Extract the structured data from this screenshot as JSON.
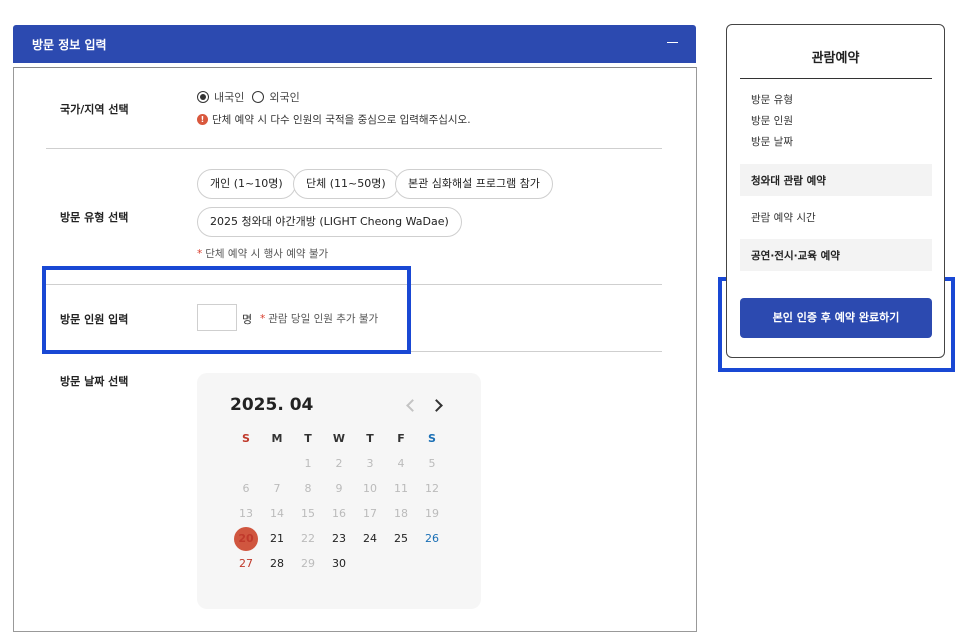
{
  "form": {
    "title": "방문 정보 입력",
    "nationality": {
      "label": "국가/지역 선택",
      "options": [
        "내국인",
        "외국인"
      ],
      "selected": "내국인",
      "notice": "단체 예약 시 다수 인원의 국적을 중심으로 입력해주십시오."
    },
    "visit_type": {
      "label": "방문 유형 선택",
      "options": [
        "개인 (1~10명)",
        "단체 (11~50명)",
        "본관 심화해설 프로그램 참가",
        "2025 청와대 야간개방 (LIGHT Cheong WaDae)"
      ],
      "note": "단체 예약 시 행사 예약 불가"
    },
    "people": {
      "label": "방문 인원 입력",
      "value": "",
      "unit": "명",
      "note": "관람 당일 인원 추가 불가"
    },
    "date": {
      "label": "방문 날짜 선택",
      "month_title": "2025. 04",
      "weekdays": [
        "S",
        "M",
        "T",
        "W",
        "T",
        "F",
        "S"
      ],
      "weeks": [
        [
          "",
          "",
          "1",
          "2",
          "3",
          "4",
          "5"
        ],
        [
          "6",
          "7",
          "8",
          "9",
          "10",
          "11",
          "12"
        ],
        [
          "13",
          "14",
          "15",
          "16",
          "17",
          "18",
          "19"
        ],
        [
          "20",
          "21",
          "22",
          "23",
          "24",
          "25",
          "26"
        ],
        [
          "27",
          "28",
          "29",
          "30",
          "",
          "",
          ""
        ]
      ],
      "selected_day": "20",
      "available_days": [
        "20",
        "21",
        "23",
        "24",
        "25",
        "26",
        "27",
        "28",
        "30"
      ]
    }
  },
  "summary": {
    "title": "관람예약",
    "items": [
      "방문 유형",
      "방문 인원",
      "방문 날짜"
    ],
    "section_1": "청와대 관람 예약",
    "item_time": "관람 예약 시간",
    "section_2": "공연·전시·교육 예약",
    "submit_label": "본인 인증 후 예약 완료하기"
  },
  "colors": {
    "primary": "#2c4ab0",
    "highlight": "#1948d4",
    "today": "#d0563f",
    "sunday": "#c0392b",
    "saturday": "#1a6fb5"
  }
}
